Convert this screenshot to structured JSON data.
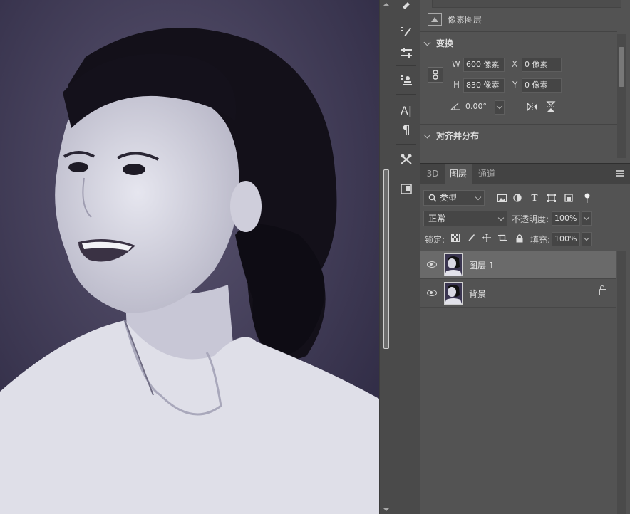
{
  "properties": {
    "layer_type": "像素图层",
    "transform_title": "变换",
    "w_label": "W",
    "w_value": "600 像素",
    "h_label": "H",
    "h_value": "830 像素",
    "x_label": "X",
    "x_value": "0 像素",
    "y_label": "Y",
    "y_value": "0 像素",
    "angle_value": "0.00°",
    "align_title": "对齐并分布"
  },
  "tabs": [
    {
      "label": "3D"
    },
    {
      "label": "图层"
    },
    {
      "label": "通道"
    }
  ],
  "layers_panel": {
    "filter_type": "类型",
    "blend_mode": "正常",
    "opacity_label": "不透明度:",
    "opacity_value": "100%",
    "lock_label": "锁定:",
    "fill_label": "填充:",
    "fill_value": "100%",
    "layers": [
      {
        "name": "图层 1",
        "selected": true,
        "visible": true,
        "locked": false
      },
      {
        "name": "背景",
        "selected": false,
        "visible": true,
        "locked": true
      }
    ]
  },
  "toolstrip_icons": [
    "history-brush-icon",
    "brush-presets-icon",
    "adjustments-icon",
    "clone-source-icon",
    "character-icon",
    "paragraph-icon",
    "tool-presets-icon",
    "notes-icon"
  ],
  "colors": {
    "panel_bg": "#535353",
    "selected_layer": "#6a6a6a"
  }
}
